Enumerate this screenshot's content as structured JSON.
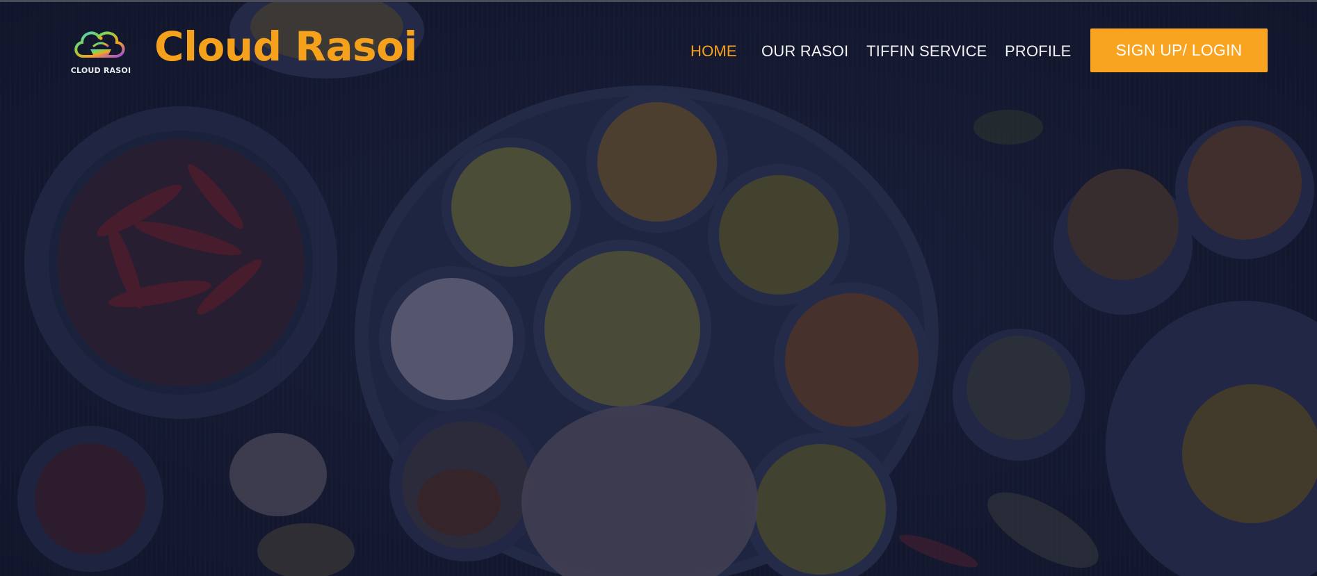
{
  "brand": {
    "logo_caption": "CLOUD RASOI",
    "name": "Cloud Rasoi"
  },
  "nav": {
    "items": [
      {
        "label": "HOME",
        "active": true
      },
      {
        "label": "OUR RASOI",
        "active": false
      },
      {
        "label": "TIFFIN SERVICE",
        "active": false
      },
      {
        "label": "PROFILE",
        "active": false
      }
    ],
    "cta_label": "SIGN UP/ LOGIN"
  },
  "colors": {
    "accent": "#f6a11c",
    "cta_background": "#f9a420",
    "nav_text": "#f3f3f5",
    "background": "#171c33"
  },
  "icons": {
    "logo": "cloud-rasoi-logo-icon"
  }
}
